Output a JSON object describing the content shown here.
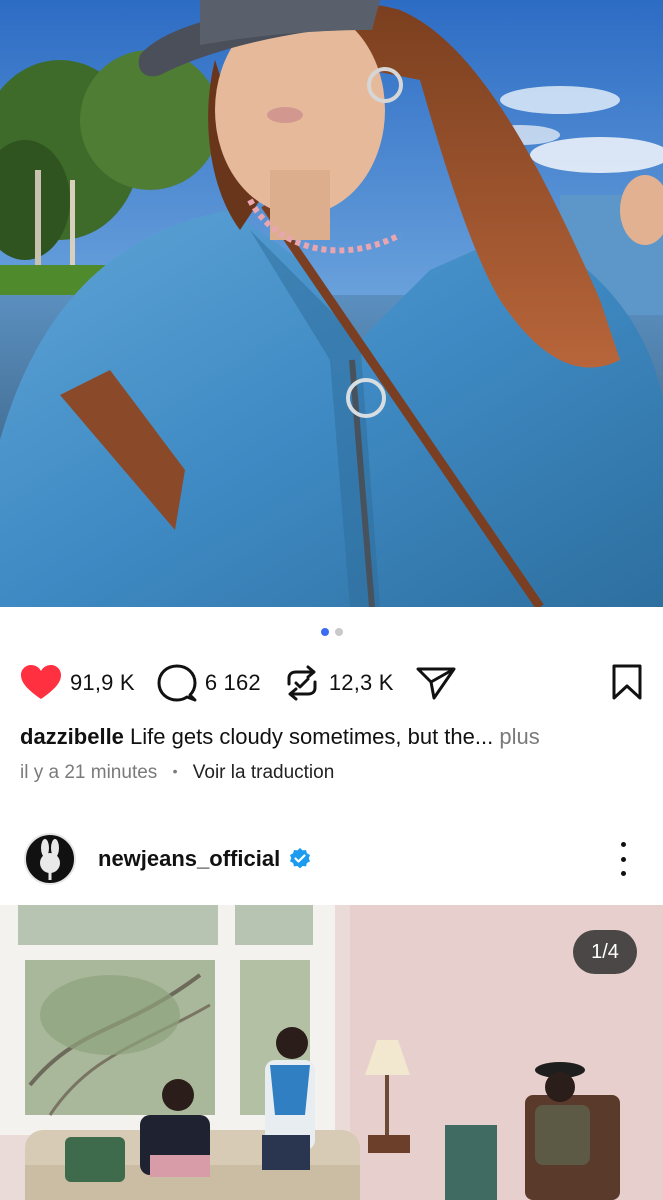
{
  "post1": {
    "carousel": {
      "total_dots": 2,
      "active_index": 0
    },
    "actions": {
      "likes": "91,9 K",
      "comments": "6 162",
      "reposts": "12,3 K",
      "like_icon": "heart-filled-icon",
      "comment_icon": "comment-bubble-icon",
      "repost_icon": "repost-icon",
      "share_icon": "send-icon",
      "save_icon": "bookmark-icon",
      "like_color": "#ff3040"
    },
    "caption": {
      "username": "dazzibelle",
      "text": "Life gets cloudy sometimes, but the...",
      "more_label": "plus"
    },
    "meta": {
      "time": "il y a 21 minutes",
      "separator": "•",
      "translate_label": "Voir la traduction"
    }
  },
  "post2": {
    "username": "newjeans_official",
    "verified": true,
    "verified_color": "#1d9bf0",
    "avatar_icon": "bunny-logo-icon",
    "menu_icon": "more-vertical-icon",
    "carousel_counter": "1/4"
  }
}
